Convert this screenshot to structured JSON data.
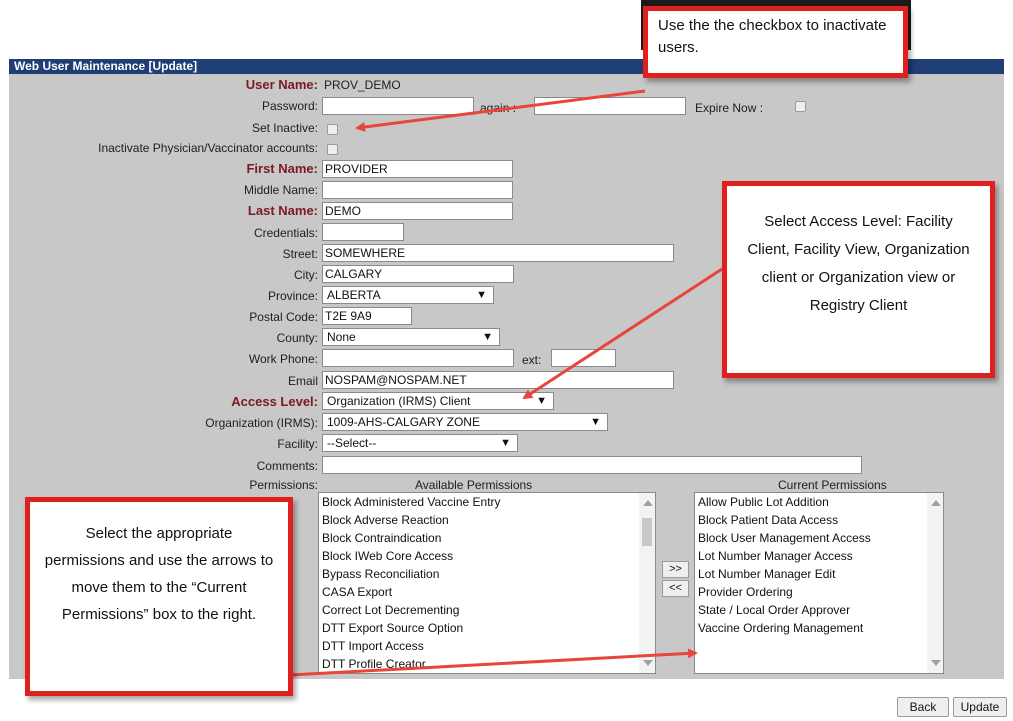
{
  "window": {
    "title": "Web User Maintenance [Update]"
  },
  "form": {
    "user_name_label": "User Name:",
    "user_name_value": "PROV_DEMO",
    "password_label": "Password:",
    "password_value": "",
    "again_label": "again :",
    "again_value": "",
    "expire_now_label": "Expire Now :",
    "set_inactive_label": "Set Inactive:",
    "inactivate_accounts_label": "Inactivate Physician/Vaccinator accounts:",
    "first_name_label": "First Name:",
    "first_name_value": "PROVIDER",
    "middle_name_label": "Middle Name:",
    "middle_name_value": "",
    "last_name_label": "Last Name:",
    "last_name_value": "DEMO",
    "credentials_label": "Credentials:",
    "credentials_value": "",
    "street_label": "Street:",
    "street_value": "SOMEWHERE",
    "city_label": "City:",
    "city_value": "CALGARY",
    "province_label": "Province:",
    "province_value": "ALBERTA",
    "postal_label": "Postal Code:",
    "postal_value": "T2E 9A9",
    "county_label": "County:",
    "county_value": "None",
    "work_phone_label": "Work Phone:",
    "work_phone_value": "",
    "ext_label": "ext:",
    "ext_value": "",
    "email_label": "Email",
    "email_value": "NOSPAM@NOSPAM.NET",
    "access_level_label": "Access Level:",
    "access_level_value": "Organization (IRMS) Client",
    "organization_label": "Organization (IRMS):",
    "organization_value": "1009-AHS-CALGARY ZONE",
    "facility_label": "Facility:",
    "facility_value": "--Select--",
    "comments_label": "Comments:",
    "comments_value": "",
    "permissions_label": "Permissions:"
  },
  "permissions": {
    "available_header": "Available Permissions",
    "current_header": "Current Permissions",
    "available": [
      "Block Administered Vaccine Entry",
      "Block Adverse Reaction",
      "Block Contraindication",
      "Block IWeb Core Access",
      "Bypass Reconciliation",
      "CASA Export",
      "Correct Lot Decrementing",
      "DTT Export Source Option",
      "DTT Import Access",
      "DTT Profile Creator"
    ],
    "current": [
      "Allow Public Lot Addition",
      "Block Patient Data Access",
      "Block User Management Access",
      "Lot Number Manager Access",
      "Lot Number Manager Edit",
      "Provider Ordering",
      "State / Local Order Approver",
      "Vaccine Ordering Management"
    ],
    "add_label": ">>",
    "remove_label": "<<"
  },
  "buttons": {
    "back": "Back",
    "update": "Update"
  },
  "callouts": {
    "checkbox": "Use the the checkbox to inactivate users.",
    "access": "Select Access Level: Facility Client, Facility View, Organization client or Organization view or Registry Client",
    "permissions": "Select the appropriate permissions and use the arrows to move them to the “Current Permissions” box to the right."
  },
  "colors": {
    "title_bar": "#1f3e74",
    "panel": "#c8c8c8",
    "required_label": "#7a1a22",
    "callout_border": "#e11f1f",
    "arrow": "#e8453c"
  },
  "icons": [
    "dropdown-arrow-icon",
    "scroll-up-icon",
    "scroll-down-icon",
    "annotation-arrow-icon"
  ]
}
